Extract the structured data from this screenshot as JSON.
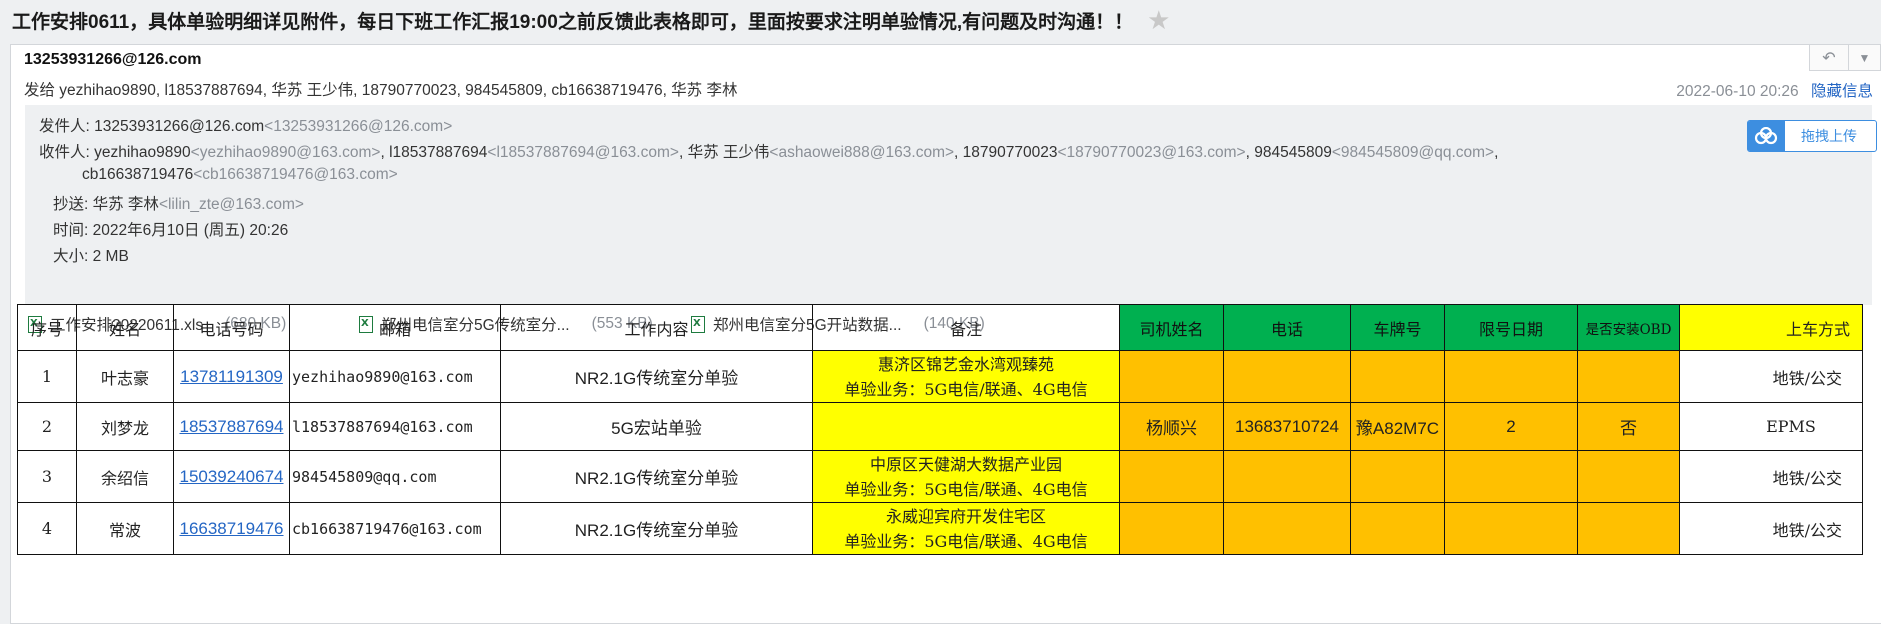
{
  "subject": "工作安排0611，具体单验明细详见附件，每日下班工作汇报19:00之前反馈此表格即可，里面按要求注明单验情况,有问题及时沟通！！",
  "star_icon": "star-icon",
  "header": {
    "from_display": "13253931266@126.com",
    "to_summary": "发给 yezhihao9890, l18537887694, 华苏 王少伟, 18790770023, 984545809, cb16638719476, 华苏 李林",
    "date": "2022-06-10 20:26",
    "hide_info": "隐藏信息",
    "reply_icon": "reply-icon",
    "more_icon": "dropdown-arrow-icon"
  },
  "details": {
    "sender_label": "发件人: ",
    "sender_name": "13253931266@126.com",
    "sender_addr": "<13253931266@126.com>",
    "recipients_label": "收件人: ",
    "r1_name": "yezhihao9890",
    "r1_addr": "<yezhihao9890@163.com>",
    "r2_name": "l18537887694",
    "r2_addr": "<l18537887694@163.com>",
    "r3_name": "华苏 王少伟",
    "r3_addr": "<ashaowei888@163.com>",
    "r4_name": "18790770023",
    "r4_addr": "<18790770023@163.com>",
    "r5_name": "984545809",
    "r5_addr": "<984545809@qq.com>",
    "r6_name": "cb16638719476",
    "r6_addr": "<cb16638719476@163.com>",
    "cc_label": "抄送: ",
    "cc_name": "华苏 李林",
    "cc_addr": "<lilin_zte@163.com>",
    "time_label": "时间: ",
    "time_value": "2022年6月10日 (周五) 20:26",
    "size_label": "大小: ",
    "size_value": "2 MB",
    "upload_label": "拖拽上传"
  },
  "attachments": [
    {
      "name": "工作安排20220611.xls",
      "size": "(680 KB)"
    },
    {
      "name": "郑州电信室分5G传统室分...",
      "size": "(553 KB)"
    },
    {
      "name": "郑州电信室分5G开站数据...",
      "size": "(140 KB)"
    }
  ],
  "table": {
    "headers": [
      "序号",
      "姓名",
      "电话号码",
      "邮箱",
      "工作内容",
      "备注",
      "司机姓名",
      "电话",
      "车牌号",
      "限号日期",
      "是否安装OBD",
      "上车方式"
    ],
    "rows": [
      {
        "no": "1",
        "name": "叶志豪",
        "phone": "13781191309",
        "email": "yezhihao9890@163.com",
        "work": "NR2.1G传统室分单验",
        "note1": "惠济区锦艺金水湾观臻苑",
        "note2": "单验业务：5G电信/联通、4G电信",
        "driver": "",
        "driver_phone": "",
        "plate": "",
        "limit_date": "",
        "obd": "",
        "board": "地铁/公交"
      },
      {
        "no": "2",
        "name": "刘梦龙",
        "phone": "18537887694",
        "email": "l18537887694@163.com",
        "work": "5G宏站单验",
        "note1": "",
        "note2": "",
        "driver": "杨顺兴",
        "driver_phone": "13683710724",
        "plate": "豫A82M7C",
        "limit_date": "2",
        "obd": "否",
        "board": "EPMS"
      },
      {
        "no": "3",
        "name": "余绍信",
        "phone": "15039240674",
        "email": "984545809@qq.com",
        "work": "NR2.1G传统室分单验",
        "note1": "中原区天健湖大数据产业园",
        "note2": "单验业务：5G电信/联通、4G电信",
        "driver": "",
        "driver_phone": "",
        "plate": "",
        "limit_date": "",
        "obd": "",
        "board": "地铁/公交"
      },
      {
        "no": "4",
        "name": "常波",
        "phone": "16638719476",
        "email": "cb16638719476@163.com",
        "work": "NR2.1G传统室分单验",
        "note1": "永威迎宾府开发住宅区",
        "note2": "单验业务：5G电信/联通、4G电信",
        "driver": "",
        "driver_phone": "",
        "plate": "",
        "limit_date": "",
        "obd": "",
        "board": "地铁/公交"
      }
    ]
  },
  "colors": {
    "link": "#2466c4",
    "green_header": "#00b050",
    "yellow": "#ffff00",
    "orange": "#ffc000"
  }
}
